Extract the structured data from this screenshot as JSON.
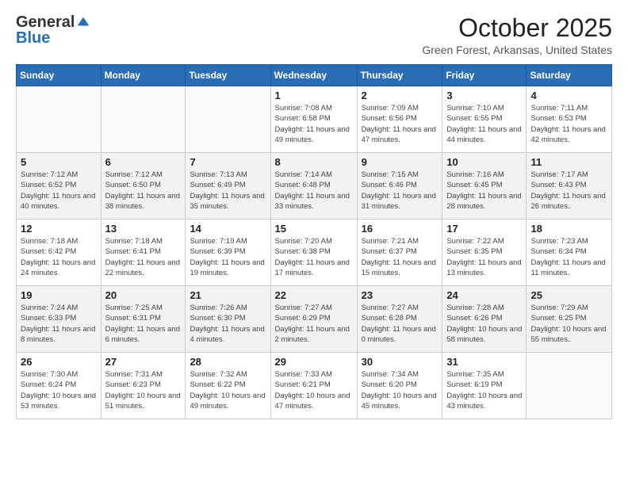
{
  "logo": {
    "general": "General",
    "blue": "Blue"
  },
  "title": "October 2025",
  "location": "Green Forest, Arkansas, United States",
  "weekdays": [
    "Sunday",
    "Monday",
    "Tuesday",
    "Wednesday",
    "Thursday",
    "Friday",
    "Saturday"
  ],
  "weeks": [
    [
      {
        "day": "",
        "info": ""
      },
      {
        "day": "",
        "info": ""
      },
      {
        "day": "",
        "info": ""
      },
      {
        "day": "1",
        "info": "Sunrise: 7:08 AM\nSunset: 6:58 PM\nDaylight: 11 hours and 49 minutes."
      },
      {
        "day": "2",
        "info": "Sunrise: 7:09 AM\nSunset: 6:56 PM\nDaylight: 11 hours and 47 minutes."
      },
      {
        "day": "3",
        "info": "Sunrise: 7:10 AM\nSunset: 6:55 PM\nDaylight: 11 hours and 44 minutes."
      },
      {
        "day": "4",
        "info": "Sunrise: 7:11 AM\nSunset: 6:53 PM\nDaylight: 11 hours and 42 minutes."
      }
    ],
    [
      {
        "day": "5",
        "info": "Sunrise: 7:12 AM\nSunset: 6:52 PM\nDaylight: 11 hours and 40 minutes."
      },
      {
        "day": "6",
        "info": "Sunrise: 7:12 AM\nSunset: 6:50 PM\nDaylight: 11 hours and 38 minutes."
      },
      {
        "day": "7",
        "info": "Sunrise: 7:13 AM\nSunset: 6:49 PM\nDaylight: 11 hours and 35 minutes."
      },
      {
        "day": "8",
        "info": "Sunrise: 7:14 AM\nSunset: 6:48 PM\nDaylight: 11 hours and 33 minutes."
      },
      {
        "day": "9",
        "info": "Sunrise: 7:15 AM\nSunset: 6:46 PM\nDaylight: 11 hours and 31 minutes."
      },
      {
        "day": "10",
        "info": "Sunrise: 7:16 AM\nSunset: 6:45 PM\nDaylight: 11 hours and 28 minutes."
      },
      {
        "day": "11",
        "info": "Sunrise: 7:17 AM\nSunset: 6:43 PM\nDaylight: 11 hours and 26 minutes."
      }
    ],
    [
      {
        "day": "12",
        "info": "Sunrise: 7:18 AM\nSunset: 6:42 PM\nDaylight: 11 hours and 24 minutes."
      },
      {
        "day": "13",
        "info": "Sunrise: 7:18 AM\nSunset: 6:41 PM\nDaylight: 11 hours and 22 minutes."
      },
      {
        "day": "14",
        "info": "Sunrise: 7:19 AM\nSunset: 6:39 PM\nDaylight: 11 hours and 19 minutes."
      },
      {
        "day": "15",
        "info": "Sunrise: 7:20 AM\nSunset: 6:38 PM\nDaylight: 11 hours and 17 minutes."
      },
      {
        "day": "16",
        "info": "Sunrise: 7:21 AM\nSunset: 6:37 PM\nDaylight: 11 hours and 15 minutes."
      },
      {
        "day": "17",
        "info": "Sunrise: 7:22 AM\nSunset: 6:35 PM\nDaylight: 11 hours and 13 minutes."
      },
      {
        "day": "18",
        "info": "Sunrise: 7:23 AM\nSunset: 6:34 PM\nDaylight: 11 hours and 11 minutes."
      }
    ],
    [
      {
        "day": "19",
        "info": "Sunrise: 7:24 AM\nSunset: 6:33 PM\nDaylight: 11 hours and 8 minutes."
      },
      {
        "day": "20",
        "info": "Sunrise: 7:25 AM\nSunset: 6:31 PM\nDaylight: 11 hours and 6 minutes."
      },
      {
        "day": "21",
        "info": "Sunrise: 7:26 AM\nSunset: 6:30 PM\nDaylight: 11 hours and 4 minutes."
      },
      {
        "day": "22",
        "info": "Sunrise: 7:27 AM\nSunset: 6:29 PM\nDaylight: 11 hours and 2 minutes."
      },
      {
        "day": "23",
        "info": "Sunrise: 7:27 AM\nSunset: 6:28 PM\nDaylight: 11 hours and 0 minutes."
      },
      {
        "day": "24",
        "info": "Sunrise: 7:28 AM\nSunset: 6:26 PM\nDaylight: 10 hours and 58 minutes."
      },
      {
        "day": "25",
        "info": "Sunrise: 7:29 AM\nSunset: 6:25 PM\nDaylight: 10 hours and 55 minutes."
      }
    ],
    [
      {
        "day": "26",
        "info": "Sunrise: 7:30 AM\nSunset: 6:24 PM\nDaylight: 10 hours and 53 minutes."
      },
      {
        "day": "27",
        "info": "Sunrise: 7:31 AM\nSunset: 6:23 PM\nDaylight: 10 hours and 51 minutes."
      },
      {
        "day": "28",
        "info": "Sunrise: 7:32 AM\nSunset: 6:22 PM\nDaylight: 10 hours and 49 minutes."
      },
      {
        "day": "29",
        "info": "Sunrise: 7:33 AM\nSunset: 6:21 PM\nDaylight: 10 hours and 47 minutes."
      },
      {
        "day": "30",
        "info": "Sunrise: 7:34 AM\nSunset: 6:20 PM\nDaylight: 10 hours and 45 minutes."
      },
      {
        "day": "31",
        "info": "Sunrise: 7:35 AM\nSunset: 6:19 PM\nDaylight: 10 hours and 43 minutes."
      },
      {
        "day": "",
        "info": ""
      }
    ]
  ]
}
